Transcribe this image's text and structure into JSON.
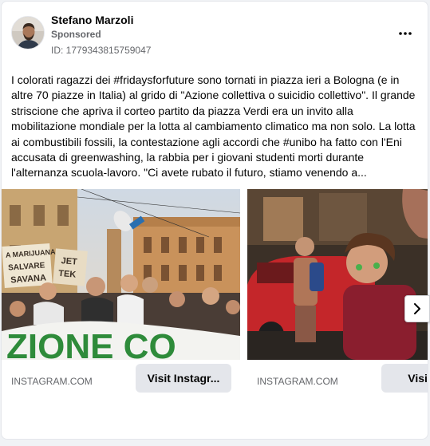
{
  "post": {
    "author": "Stefano Marzoli",
    "sponsored_label": "Sponsored",
    "id_text": "ID: 1779343815759047",
    "body": "I colorati ragazzi dei #fridaysforfuture sono tornati in piazza ieri a Bologna (e in altre 70 piazze in Italia) al grido di \"Azione collettiva o suicidio collettivo\". Il grande striscione che apriva il corteo partito da piazza Verdi era un invito alla mobilitazione mondiale per la lotta al cambiamento climatico ma non solo. La lotta ai combustibili fossili, la contestazione agli accordi che #unibo ha fatto con l'Eni accusata di greenwashing, la rabbia per i giovani studenti morti durante l'alternanza scuola-lavoro. \"Ci avete rubato il futuro, stiamo venendo a..."
  },
  "carousel": {
    "cards": [
      {
        "domain": "INSTAGRAM.COM",
        "cta": "Visit Instagr...",
        "photo_signs": [
          "A MARIJUANA",
          "SALVARE",
          "SAVANA",
          "JET",
          "TEK"
        ],
        "banner_text": "ZIONE CO"
      },
      {
        "domain": "INSTAGRAM.COM",
        "cta": "Visit Ins"
      }
    ]
  },
  "icons": {
    "more": "more-horizontal-icon",
    "next": "chevron-right-icon"
  },
  "colors": {
    "text_primary": "#050505",
    "text_secondary": "#65676b",
    "button_bg": "#e4e6eb",
    "banner_green": "#2e8b3a"
  }
}
